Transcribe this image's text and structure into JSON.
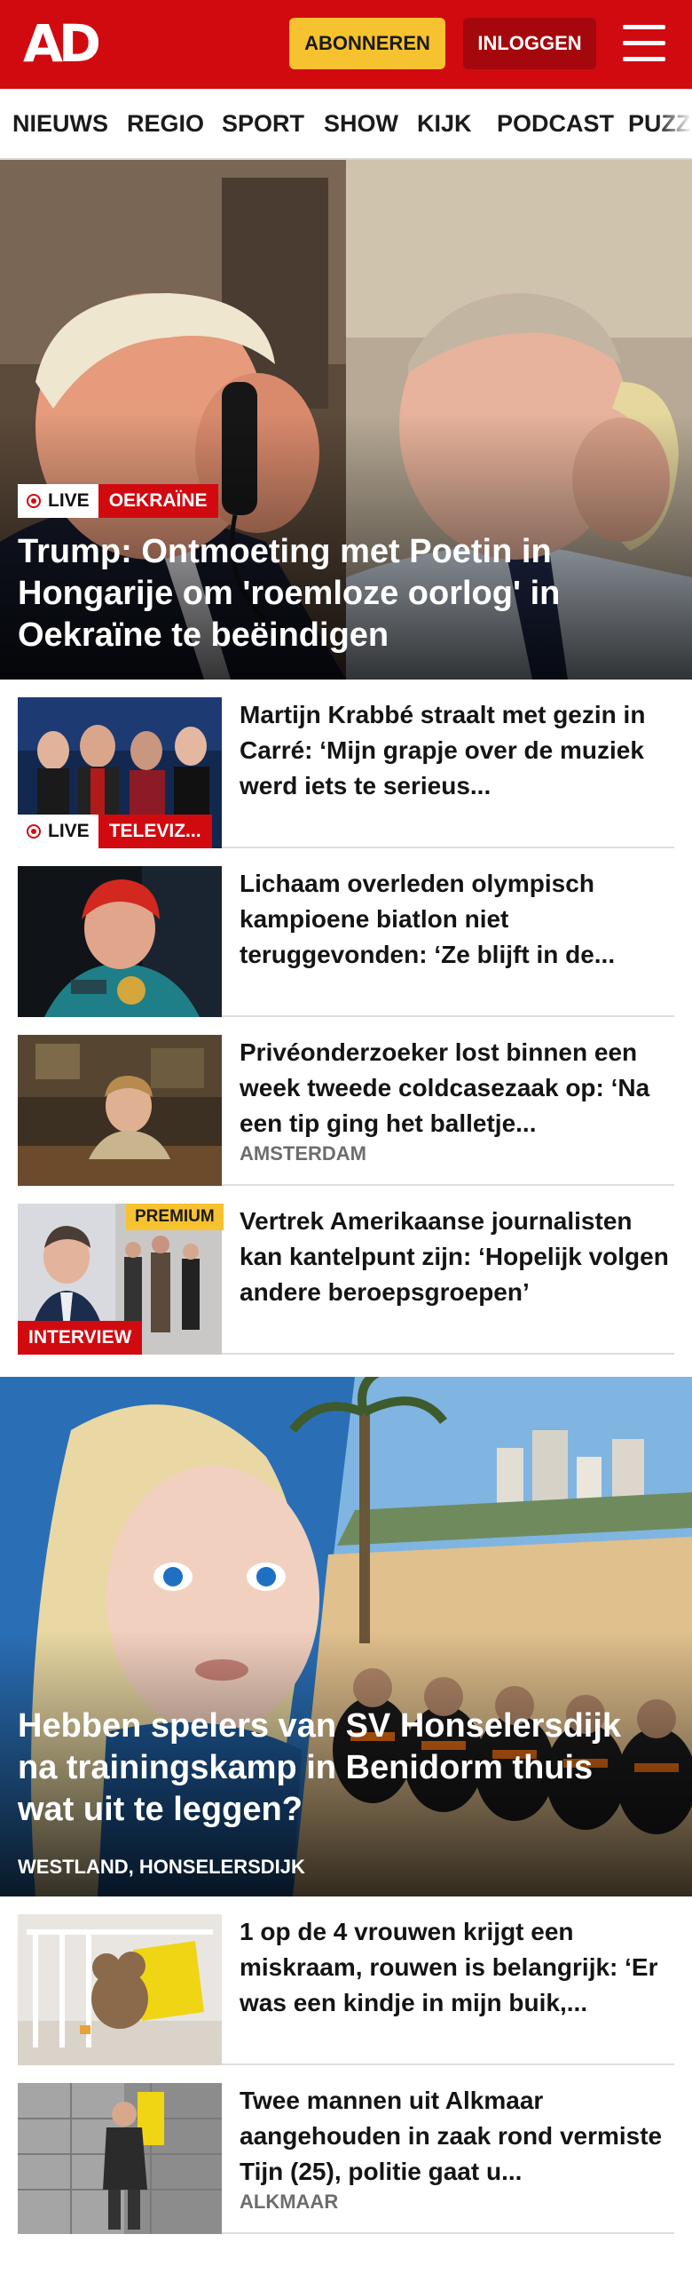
{
  "header": {
    "logo": "AD",
    "subscribe_label": "ABONNEREN",
    "login_label": "INLOGGEN"
  },
  "nav": {
    "items": [
      "NIEUWS",
      "REGIO",
      "SPORT",
      "SHOW",
      "KIJK",
      "PODCAST",
      "PUZZ"
    ]
  },
  "hero_main": {
    "live_label": "LIVE",
    "tag": "OEKRAÏNE",
    "title": "Trump: Ontmoeting met Poetin in Hongarije om 'roemloze oorlog' in Oekraïne te beëindigen"
  },
  "articles": [
    {
      "title": "Martijn Krabbé straalt met gezin in Carré: ‘Mijn grapje over de muziek werd iets te serieus...",
      "live_label": "LIVE",
      "tag": "TELEVIZ..."
    },
    {
      "title": "Lichaam overleden olympisch kampioene biatlon niet teruggevonden: ‘Ze blijft in de..."
    },
    {
      "title": "Privéonderzoeker lost binnen een week tweede coldcasezaak op: ‘Na een tip ging het balletje...",
      "location": "AMSTERDAM"
    },
    {
      "title": "Vertrek Amerikaanse journalis­ten kan kantelpunt zijn: ‘Hopelijk volgen andere beroepsgroepen’",
      "premium_label": "PREMIUM",
      "tag": "INTERVIEW"
    }
  ],
  "hero_second": {
    "title": "Hebben spelers van SV Honselersdijk na trainingskamp in Benidorm thuis wat uit te leggen?",
    "location": "WESTLAND, HONSELERSDIJK"
  },
  "articles_2": [
    {
      "title": "1 op de 4 vrouwen krijgt een miskraam, rouwen is belangrijk: ‘Er was een kindje in mijn buik,..."
    },
    {
      "title": "Twee mannen uit Alkmaar aangehouden in zaak rond vermiste Tijn (25), politie gaat u...",
      "location": "ALKMAAR"
    }
  ],
  "colors": {
    "brand_red": "#d10a10",
    "subscribe_yellow": "#f7c22f",
    "login_dark_red": "#a4080d",
    "location_grey": "#6d6d6d"
  },
  "icons": [
    "menu-icon",
    "live-dot-icon"
  ]
}
